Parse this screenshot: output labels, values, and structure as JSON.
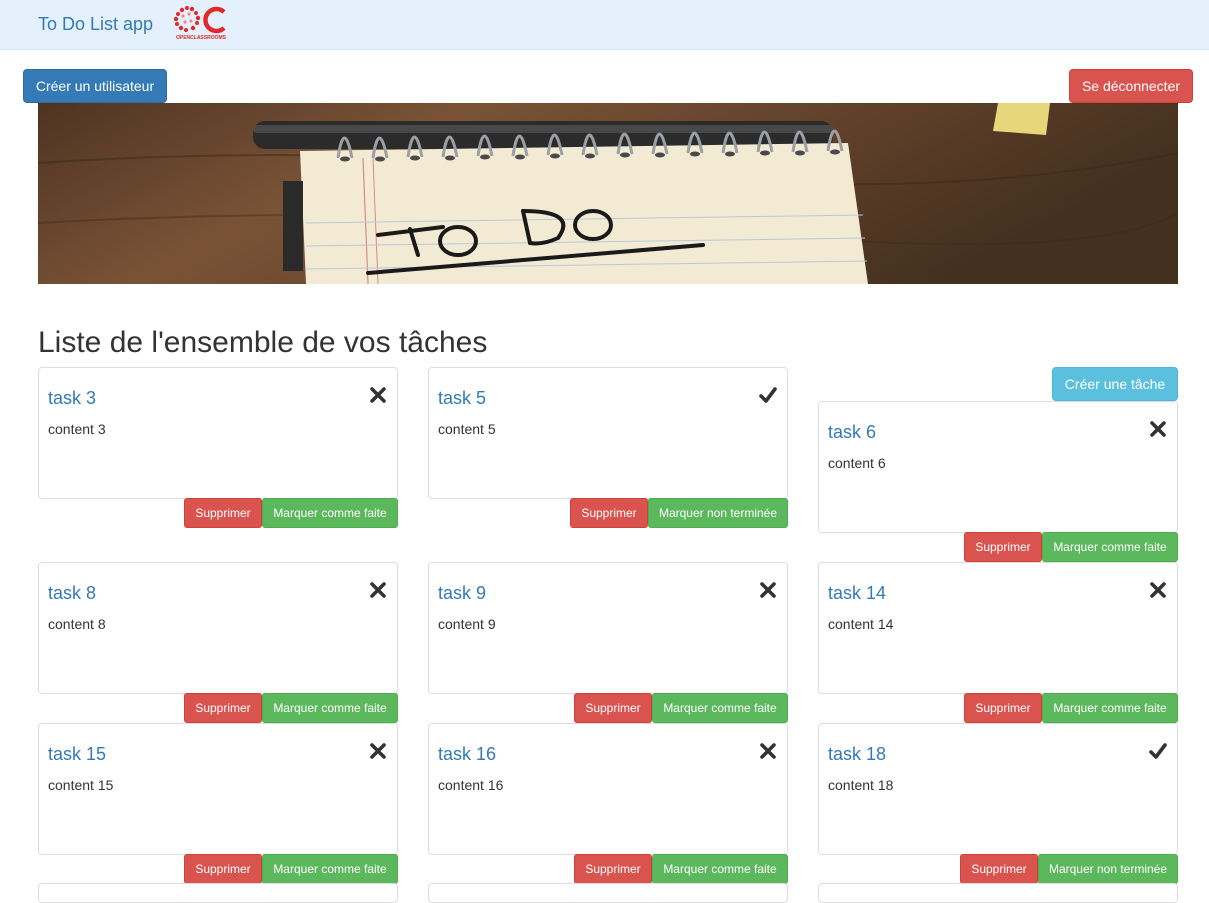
{
  "navbar": {
    "brand": "To Do List app",
    "logo_text": "OPENCLASSROOMS",
    "logo_icon": "openclassrooms-logo"
  },
  "header": {
    "create_user_label": "Créer un utilisateur",
    "logout_label": "Se déconnecter"
  },
  "hero": {
    "image": "to-do-notepad-photo"
  },
  "page": {
    "title": "Liste de l'ensemble de vos tâches",
    "create_task_label": "Créer une tâche"
  },
  "colors": {
    "link": "#337ab7",
    "danger": "#d9534f",
    "success": "#5cb85c",
    "info": "#5bc0de",
    "navbar": "#e4f1fc"
  },
  "tasks": [
    {
      "title": "task 3",
      "content": "content 3",
      "done": false,
      "delete_label": "Supprimer",
      "toggle_label": "Marquer comme faite"
    },
    {
      "title": "task 5",
      "content": "content 5",
      "done": true,
      "delete_label": "Supprimer",
      "toggle_label": "Marquer non terminée"
    },
    {
      "title": "task 6",
      "content": "content 6",
      "done": false,
      "delete_label": "Supprimer",
      "toggle_label": "Marquer comme faite"
    },
    {
      "title": "task 8",
      "content": "content 8",
      "done": false,
      "delete_label": "Supprimer",
      "toggle_label": "Marquer comme faite"
    },
    {
      "title": "task 9",
      "content": "content 9",
      "done": false,
      "delete_label": "Supprimer",
      "toggle_label": "Marquer comme faite"
    },
    {
      "title": "task 14",
      "content": "content 14",
      "done": false,
      "delete_label": "Supprimer",
      "toggle_label": "Marquer comme faite"
    },
    {
      "title": "task 15",
      "content": "content 15",
      "done": false,
      "delete_label": "Supprimer",
      "toggle_label": "Marquer comme faite"
    },
    {
      "title": "task 16",
      "content": "content 16",
      "done": false,
      "delete_label": "Supprimer",
      "toggle_label": "Marquer comme faite"
    },
    {
      "title": "task 18",
      "content": "content 18",
      "done": true,
      "delete_label": "Supprimer",
      "toggle_label": "Marquer non terminée"
    }
  ]
}
